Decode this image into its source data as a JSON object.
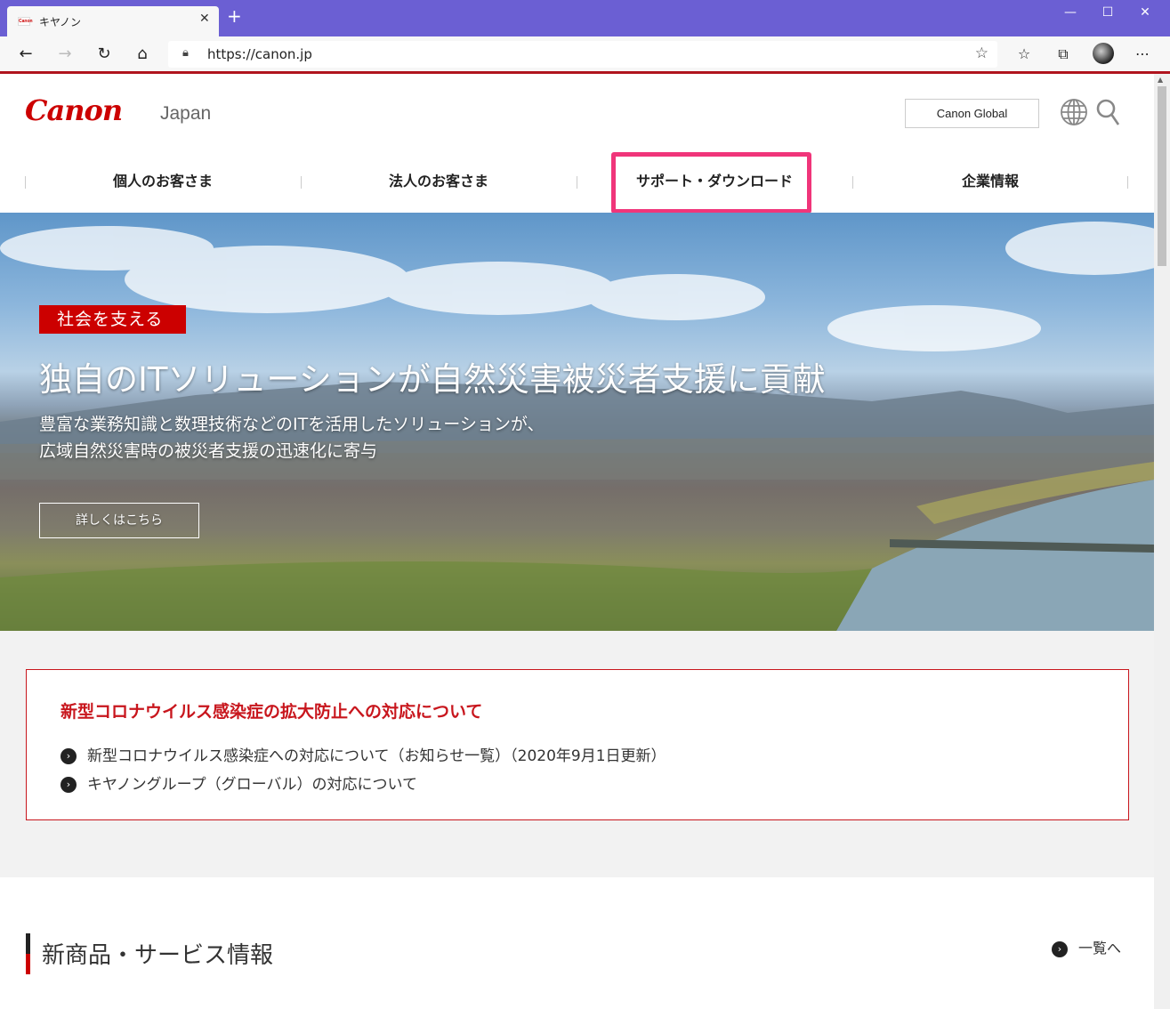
{
  "browser": {
    "tab_title": "キヤノン",
    "favicon_text": "Canon",
    "url": "https://canon.jp",
    "new_tab": "+",
    "minimize": "—",
    "maximize": "☐",
    "close": "✕"
  },
  "header": {
    "logo": "Canon",
    "region": "Japan",
    "global_button": "Canon Global"
  },
  "nav": {
    "items": [
      "個人のお客さま",
      "法人のお客さま",
      "サポート・ダウンロード",
      "企業情報"
    ]
  },
  "hero": {
    "label": "社会を支える",
    "title": "独自のITソリューションが自然災害被災者支援に貢献",
    "subtitle_1": "豊富な業務知識と数理技術などのITを活用したソリューションが、",
    "subtitle_2": "広域自然災害時の被災者支援の迅速化に寄与",
    "button": "詳しくはこちら"
  },
  "notice": {
    "title": "新型コロナウイルス感染症の拡大防止への対応について",
    "links": [
      "新型コロナウイルス感染症への対応について（お知らせ一覧）（2020年9月1日更新）",
      "キヤノングループ（グローバル）の対応について"
    ]
  },
  "section": {
    "title": "新商品・サービス情報",
    "more": "一覧へ"
  },
  "colors": {
    "brand_red": "#cc0000",
    "highlight": "#f0357a",
    "titlebar": "#6b5fd3"
  }
}
